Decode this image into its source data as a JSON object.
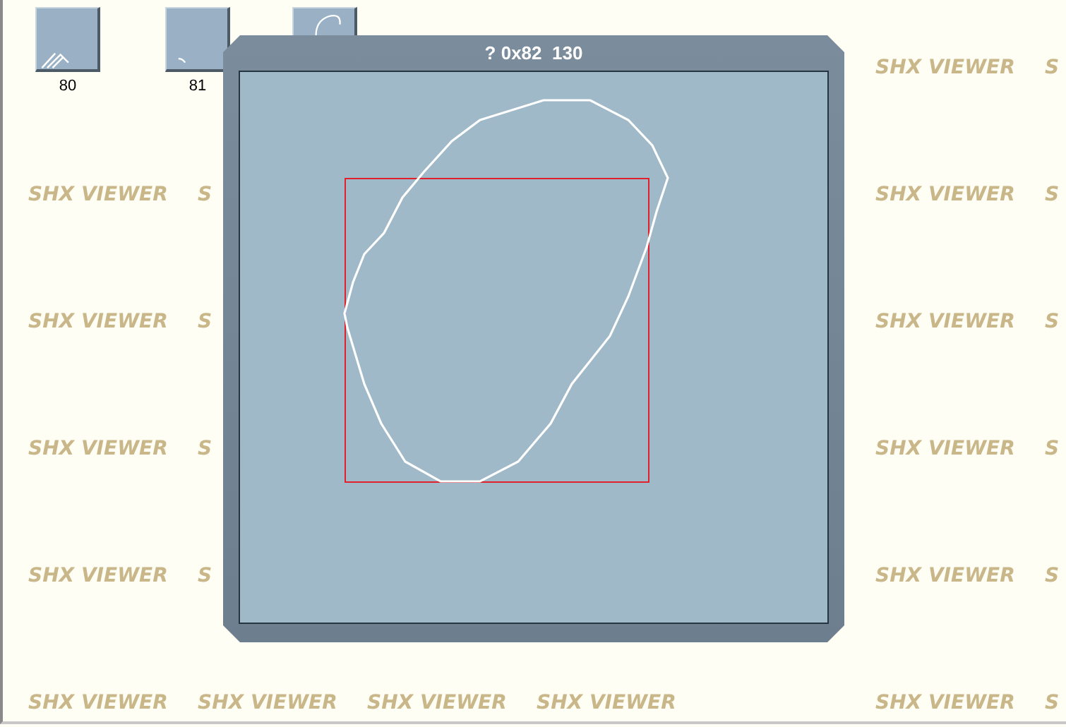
{
  "thumbnails": [
    {
      "kind": "labelled",
      "label": "80"
    },
    {
      "kind": "labelled",
      "label": "81"
    },
    {
      "kind": "covered"
    }
  ],
  "preview": {
    "title": "? 0x82  130"
  },
  "watermark_rows": [
    {
      "left": [],
      "right": [
        "SHX VIEWER",
        "S"
      ]
    },
    {
      "left": [
        "SHX VIEWER",
        "S"
      ],
      "right": [
        "SHX VIEWER",
        "S"
      ]
    },
    {
      "left": [
        "SHX VIEWER",
        "S"
      ],
      "right": [
        "SHX VIEWER",
        "S"
      ]
    },
    {
      "left": [
        "SHX VIEWER",
        "S"
      ],
      "right": [
        "SHX VIEWER",
        "S"
      ]
    },
    {
      "left": [
        "SHX VIEWER",
        "S"
      ],
      "right": [
        "SHX VIEWER",
        "S"
      ]
    },
    {
      "left": [
        "SHX VIEWER",
        "SHX VIEWER",
        "SHX VIEWER",
        "SHX VIEWER"
      ],
      "right": [
        "SHX VIEWER",
        "S"
      ]
    }
  ]
}
